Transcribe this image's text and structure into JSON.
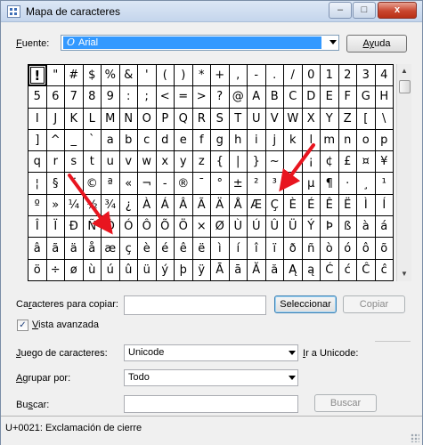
{
  "window": {
    "title": "Mapa de caracteres",
    "buttons": {
      "minimize": "–",
      "maximize": "□",
      "close": "x"
    }
  },
  "font": {
    "label_underlined": "F",
    "label_rest": "uente:",
    "selected": "Arial",
    "icon": "opentype-font-icon",
    "help_label_underlined": "Ay",
    "help_label_rest": "uda"
  },
  "grid": {
    "rows": [
      [
        "!",
        "\"",
        "#",
        "$",
        "%",
        "&",
        "'",
        "(",
        ")",
        "*",
        "+",
        ",",
        "-",
        ".",
        "/",
        "0",
        "1",
        "2",
        "3",
        "4"
      ],
      [
        "5",
        "6",
        "7",
        "8",
        "9",
        ":",
        ";",
        "<",
        "=",
        ">",
        "?",
        "@",
        "A",
        "B",
        "C",
        "D",
        "E",
        "F",
        "G",
        "H"
      ],
      [
        "I",
        "J",
        "K",
        "L",
        "M",
        "N",
        "O",
        "P",
        "Q",
        "R",
        "S",
        "T",
        "U",
        "V",
        "W",
        "X",
        "Y",
        "Z",
        "[",
        "\\"
      ],
      [
        "]",
        "^",
        "_",
        "`",
        "a",
        "b",
        "c",
        "d",
        "e",
        "f",
        "g",
        "h",
        "i",
        "j",
        "k",
        "l",
        "m",
        "n",
        "o",
        "p"
      ],
      [
        "q",
        "r",
        "s",
        "t",
        "u",
        "v",
        "w",
        "x",
        "y",
        "z",
        "{",
        "|",
        "}",
        "~",
        "",
        "¡",
        "¢",
        "£",
        "¤",
        "¥"
      ],
      [
        "¦",
        "§",
        "¨",
        "©",
        "ª",
        "«",
        "¬",
        "-",
        "®",
        "¯",
        "°",
        "±",
        "²",
        "³",
        "´",
        "µ",
        "¶",
        "·",
        "¸",
        "¹"
      ],
      [
        "º",
        "»",
        "¼",
        "½",
        "¾",
        "¿",
        "À",
        "Á",
        "Â",
        "Ã",
        "Ä",
        "Å",
        "Æ",
        "Ç",
        "È",
        "É",
        "Ê",
        "Ë",
        "Ì",
        "Í"
      ],
      [
        "Î",
        "Ï",
        "Ð",
        "Ñ",
        "Ò",
        "Ó",
        "Ô",
        "Õ",
        "Ö",
        "×",
        "Ø",
        "Ù",
        "Ú",
        "Û",
        "Ü",
        "Ý",
        "Þ",
        "ß",
        "à",
        "á"
      ],
      [
        "â",
        "ã",
        "ä",
        "å",
        "æ",
        "ç",
        "è",
        "é",
        "ê",
        "ë",
        "ì",
        "í",
        "î",
        "ï",
        "ð",
        "ñ",
        "ò",
        "ó",
        "ô",
        "õ"
      ],
      [
        "ö",
        "÷",
        "ø",
        "ù",
        "ú",
        "û",
        "ü",
        "ý",
        "þ",
        "ÿ",
        "Ā",
        "ā",
        "Ă",
        "ă",
        "Ą",
        "ą",
        "Ć",
        "ć",
        "Ĉ",
        "ĉ"
      ]
    ],
    "selected_char": "!"
  },
  "copy": {
    "label_pre": "Ca",
    "label_underlined": "r",
    "label_rest": "acteres para copiar:",
    "value": "",
    "select_button": "Seleccionar",
    "copy_button": "Copiar"
  },
  "advanced": {
    "checked": true,
    "check_mark": "✓",
    "label_underlined": "V",
    "label_rest": "ista avanzada"
  },
  "charset": {
    "label_underlined": "J",
    "label_rest": "uego de caracteres:",
    "value": "Unicode",
    "goto_label_underlined": "I",
    "goto_label_rest": "r a Unicode:"
  },
  "group": {
    "label_underlined": "A",
    "label_rest": "grupar por:",
    "value": "Todo"
  },
  "search": {
    "label_pre": "Bu",
    "label_underlined": "s",
    "label_rest": "car:",
    "value": "",
    "button": "Buscar"
  },
  "status": {
    "text": "U+0021: Exclamación de cierre"
  },
  "annotation_color": "#e8151f"
}
